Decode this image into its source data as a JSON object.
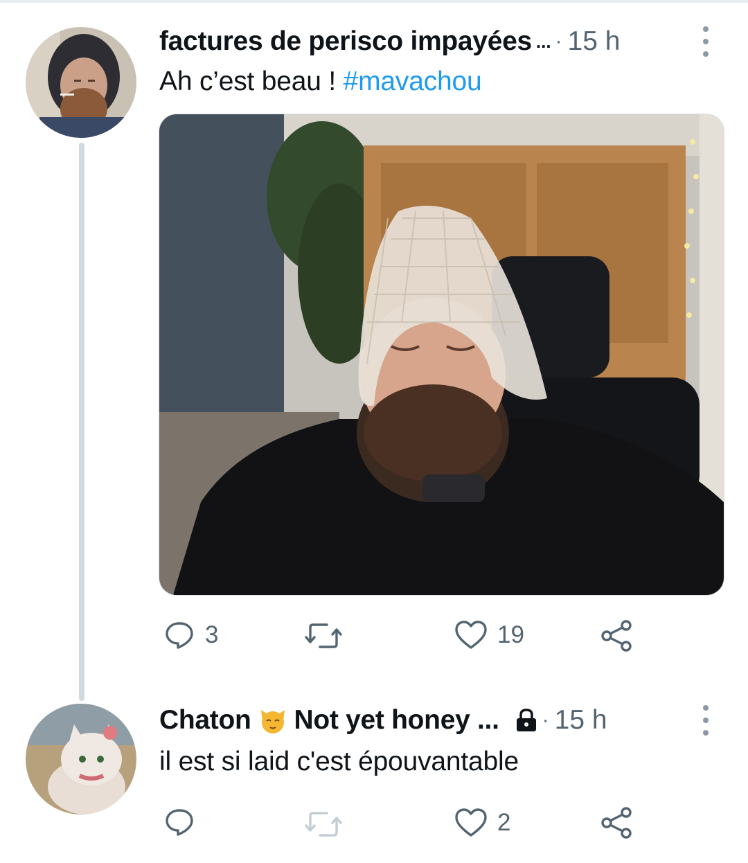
{
  "thread": [
    {
      "author": "factures de perisco impayées",
      "name_truncation": "...",
      "separator": "·",
      "time": "15 h",
      "text": "Ah c’est beau ! ",
      "hashtag": "#mavachou",
      "reply_count": "3",
      "retweet_count": "",
      "like_count": "19",
      "has_media": true
    },
    {
      "author": "Chaton",
      "author_suffix": "Not yet honey ...",
      "separator": "·",
      "time": "15 h",
      "text": "il est si laid c'est épouvantable",
      "reply_count": "",
      "retweet_count": "",
      "like_count": "2",
      "protected": true
    }
  ],
  "icons": {
    "reply": "reply-icon",
    "retweet": "retweet-icon",
    "like": "heart-icon",
    "share": "share-icon",
    "more": "more-options-icon",
    "lock": "lock-icon",
    "cat_emoji": "cat-face-emoji"
  },
  "colors": {
    "link": "#1d9bf0",
    "secondary_text": "#536471",
    "thread_line": "#cfd9de"
  }
}
